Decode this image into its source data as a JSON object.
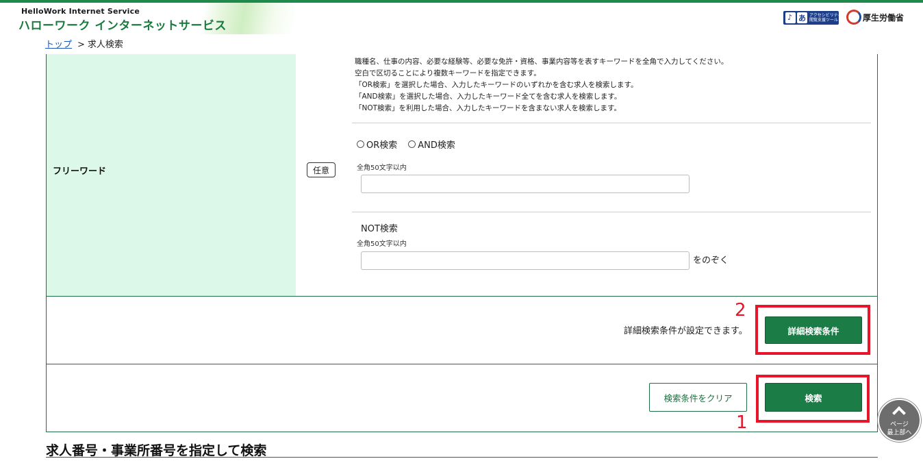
{
  "header": {
    "logo_en": "HelloWork Internet Service",
    "logo_jp": "ハローワーク インターネットサービス",
    "accessibility_icon1": "♪",
    "accessibility_icon2": "あ",
    "accessibility_text_line1": "アクセシビリティ",
    "accessibility_text_line2": "閲覧支援ツール",
    "ministry": "厚生労働省"
  },
  "breadcrumb": {
    "top_link": "トップ",
    "separator": ">",
    "current": "求人検索"
  },
  "freeword": {
    "label": "フリーワード",
    "optional_badge": "任意",
    "help_lines": [
      "職種名、仕事の内容、必要な経験等、必要な免許・資格、事業内容等を表すキーワードを全角で入力してください。",
      "空白で区切ることにより複数キーワードを指定できます。",
      "「OR検索」を選択した場合、入力したキーワードのいずれかを含む求人を検索します。",
      "「AND検索」を選択した場合、入力したキーワード全てを含む求人を検索します。",
      "「NOT検索」を利用した場合、入力したキーワードを含まない求人を検索します。"
    ],
    "radio_or": "OR検索",
    "radio_and": "AND検索",
    "hint1": "全角50文字以内",
    "keyword_value": "",
    "not_title": "NOT検索",
    "hint2": "全角50文字以内",
    "not_value": "",
    "exclude_suffix": "をのぞく"
  },
  "detail": {
    "text": "詳細検索条件が設定できます。",
    "button_label": "詳細検索条件",
    "annotation_number": "2"
  },
  "search": {
    "clear_label": "検索条件をクリア",
    "search_label": "検索",
    "annotation_number": "1"
  },
  "section": {
    "title": "求人番号・事業所番号を指定して検索"
  },
  "pagetop": {
    "line1": "ページ",
    "line2": "最上部へ"
  },
  "colors": {
    "accent_green": "#1c7c46",
    "label_bg": "#dcf8e9",
    "annotation_red": "#e8152a"
  }
}
